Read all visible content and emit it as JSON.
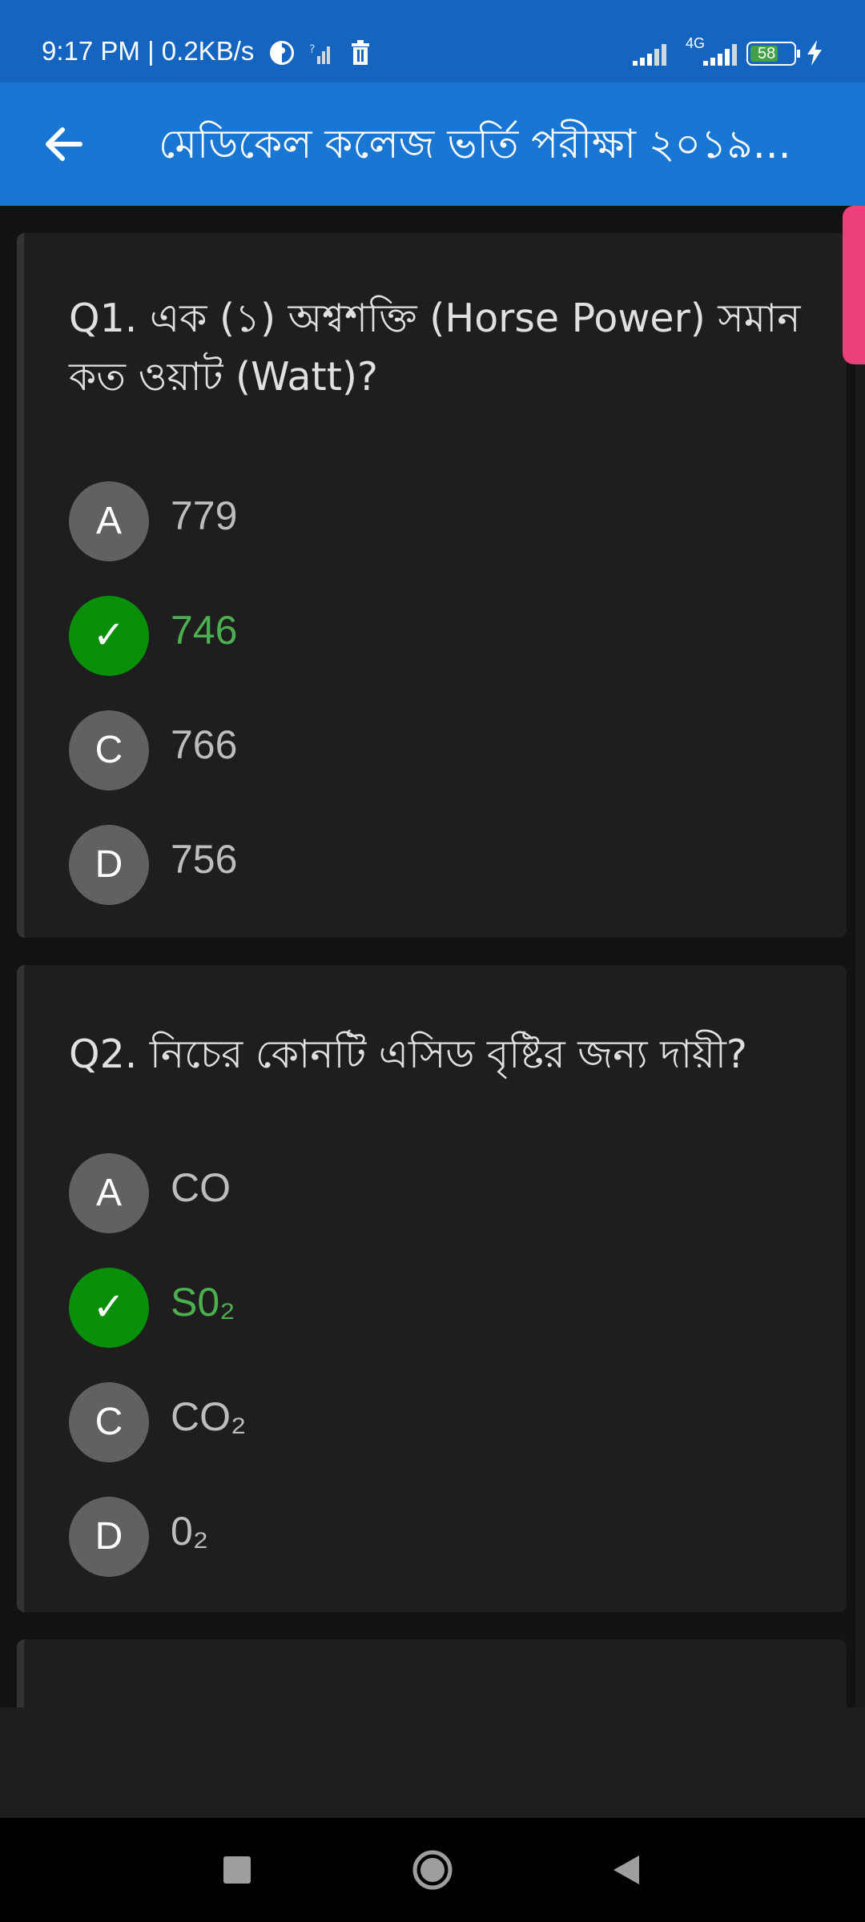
{
  "status_bar": {
    "time_text": "9:17 PM | 0.2KB/s",
    "network_label": "4G",
    "battery_level": "58"
  },
  "app_bar": {
    "title": "মেডিকেল কলেজ ভর্তি পরীক্ষা ২০১৯..."
  },
  "questions": [
    {
      "text": "Q1. এক (১) অশ্বশক্তি (Horse Power) সমান কত ওয়াট (Watt)?",
      "options": [
        {
          "letter": "A",
          "text": "779",
          "correct": false
        },
        {
          "letter": "✓",
          "text": "746",
          "correct": true
        },
        {
          "letter": "C",
          "text": "766",
          "correct": false
        },
        {
          "letter": "D",
          "text": "756",
          "correct": false
        }
      ]
    },
    {
      "text": "Q2. নিচের কোনটি এসিড বৃষ্টির জন্য দায়ী?",
      "options": [
        {
          "letter": "A",
          "text": "CO",
          "correct": false
        },
        {
          "letter": "✓",
          "text": "S0₂",
          "correct": true
        },
        {
          "letter": "C",
          "text": "CO₂",
          "correct": false
        },
        {
          "letter": "D",
          "text": "0₂",
          "correct": false
        }
      ]
    }
  ],
  "colors": {
    "status_bar": "#1565c0",
    "app_bar": "#1976d2",
    "correct": "#0a8f0a",
    "scroll_thumb": "#ec407a"
  }
}
